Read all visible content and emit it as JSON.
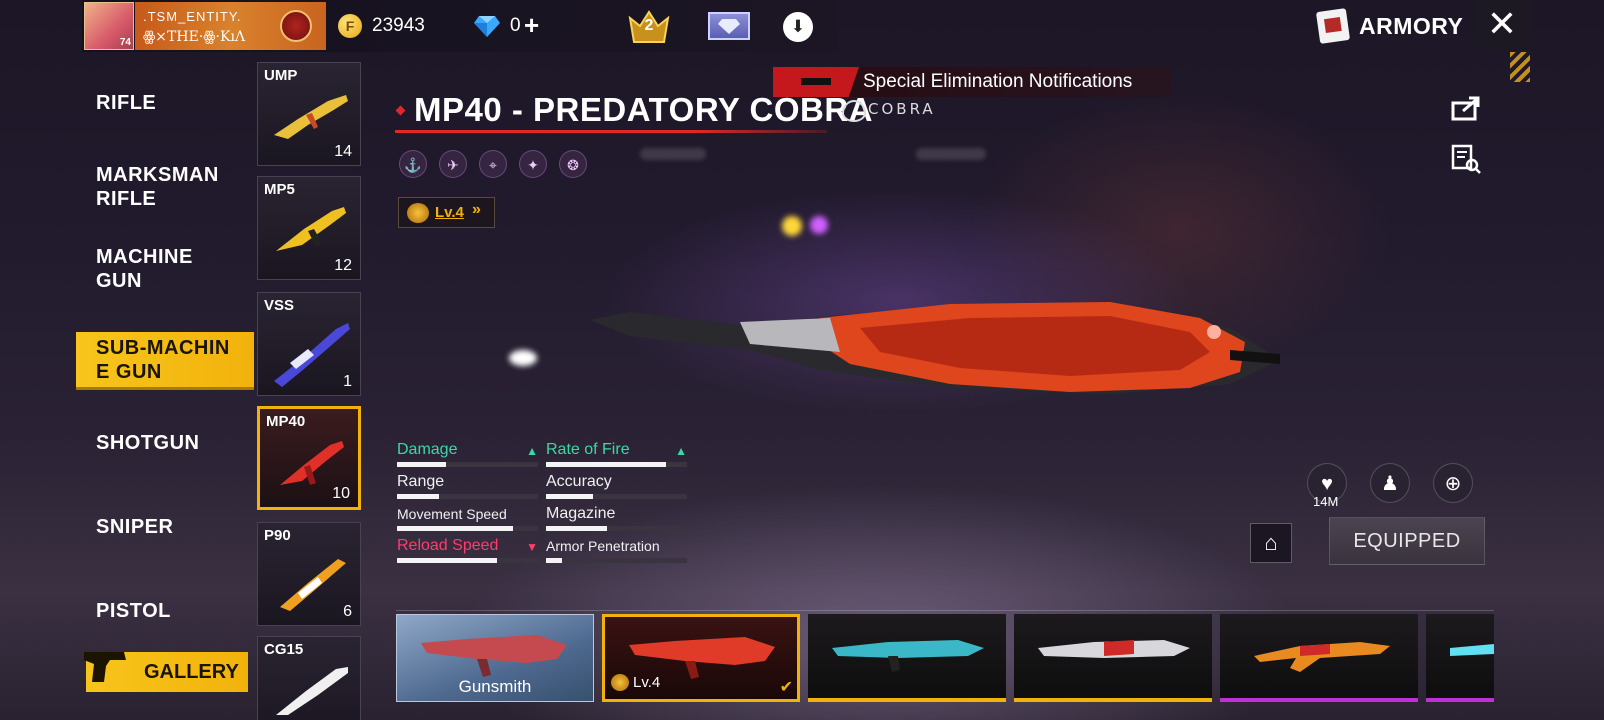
{
  "profile": {
    "level": "74",
    "name": ".TSM_ENTITY.",
    "guild": "ꙮ×THE·ꙮ·KıɅ"
  },
  "currency": {
    "gold": "23943",
    "gold_symbol": "F",
    "diamonds": "0",
    "plus": "+"
  },
  "rank": {
    "value": "2"
  },
  "header": {
    "title": "ARMORY",
    "close": "✕"
  },
  "categories": [
    {
      "label": "RIFLE",
      "active": false
    },
    {
      "label": "MARKSMAN\nRIFLE",
      "active": false
    },
    {
      "label": "MACHINE\nGUN",
      "active": false
    },
    {
      "label": "SUB-MACHIN\nE GUN",
      "active": true
    },
    {
      "label": "SHOTGUN",
      "active": false
    },
    {
      "label": "SNIPER",
      "active": false
    },
    {
      "label": "PISTOL",
      "active": false
    }
  ],
  "gallery": {
    "label": "GALLERY"
  },
  "weapons": [
    {
      "name": "UMP",
      "count": "14"
    },
    {
      "name": "MP5",
      "count": "12"
    },
    {
      "name": "VSS",
      "count": "1"
    },
    {
      "name": "MP40",
      "count": "10"
    },
    {
      "name": "P90",
      "count": "6"
    },
    {
      "name": "CG15",
      "count": ""
    }
  ],
  "notification": {
    "text": "Special Elimination Notifications"
  },
  "gun": {
    "title": "MP40 - PREDATORY COBRA",
    "brand": "COBRA",
    "level": "Lv.4",
    "level_arrow": "»",
    "attributes": [
      "⚓",
      "✈",
      "⌖",
      "✦",
      "❂"
    ]
  },
  "stats": [
    {
      "label": "Damage",
      "value": 0.35,
      "trend": "up"
    },
    {
      "label": "Rate of Fire",
      "value": 0.85,
      "trend": "up"
    },
    {
      "label": "Range",
      "value": 0.3,
      "trend": ""
    },
    {
      "label": "Accuracy",
      "value": 0.33,
      "trend": ""
    },
    {
      "label": "Movement Speed",
      "value": 0.82,
      "trend": ""
    },
    {
      "label": "Magazine",
      "value": 0.43,
      "trend": ""
    },
    {
      "label": "Reload Speed",
      "value": 0.71,
      "trend": "down"
    },
    {
      "label": "Armor Penetration",
      "value": 0.11,
      "trend": ""
    }
  ],
  "actions": {
    "likes": "14M",
    "equipped": "EQUIPPED"
  },
  "skins": [
    {
      "label": "Gunsmith",
      "type": "gunsmith"
    },
    {
      "label": "Lv.4",
      "type": "current",
      "rarity_color": "#f2b20c"
    },
    {
      "label": "",
      "type": "plain",
      "rarity_color": "#f2b20c"
    },
    {
      "label": "",
      "type": "plain",
      "rarity_color": "#f2b20c"
    },
    {
      "label": "",
      "type": "plain",
      "rarity_color": "#c030d8"
    },
    {
      "label": "",
      "type": "plain",
      "rarity_color": "#c030d8"
    }
  ],
  "colors": {
    "accent": "#f2b20c",
    "title_red": "#e02828",
    "stat_up": "#3ad9a4",
    "stat_down": "#ff3c6e"
  }
}
